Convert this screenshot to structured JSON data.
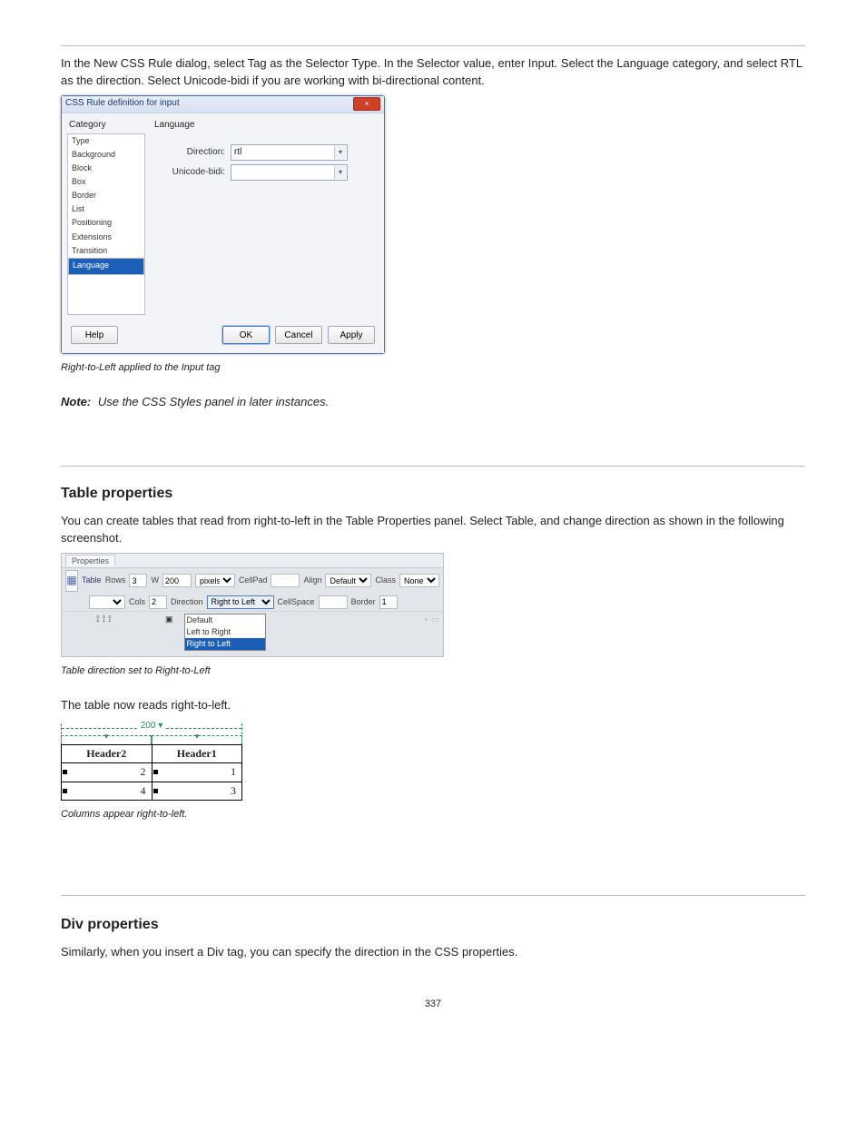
{
  "intro_paragraph": "In the New CSS Rule dialog, select Tag as the Selector Type. In the Selector value, enter Input. Select the Language category, and select RTL as the direction. Select Unicode-bidi if you are working with bi-directional content.",
  "dialog": {
    "title": "CSS Rule definition for input",
    "category_label": "Category",
    "right_label": "Language",
    "direction_label": "Direction:",
    "unicode_label": "Unicode-bidi:",
    "direction_value": "rtl",
    "unicode_value": "",
    "categories": [
      "Type",
      "Background",
      "Block",
      "Box",
      "Border",
      "List",
      "Positioning",
      "Extensions",
      "Transition",
      "Language"
    ],
    "selected_category_index": 9,
    "buttons": {
      "help": "Help",
      "ok": "OK",
      "cancel": "Cancel",
      "apply": "Apply"
    },
    "close_label": "×"
  },
  "caption1": "Right-to-Left applied to the Input tag",
  "note_label": "Note:",
  "note_text": "Use the CSS Styles panel in later instances.",
  "section_title": "Table properties",
  "para2a": "You can create tables that read from right-to-left in the Table Properties panel. Select Table, and change direction as shown in the following screenshot.",
  "props": {
    "tab": "Properties",
    "table_label": "Table",
    "rows_label": "Rows",
    "rows_value": "3",
    "cols_label": "Cols",
    "cols_value": "2",
    "w_label": "W",
    "w_value": "200",
    "w_unit": "pixels",
    "dir_label": "Direction",
    "dir_value": "Right to Left",
    "cellpad_label": "CellPad",
    "cellpad_value": "",
    "cellspace_label": "CellSpace",
    "cellspace_value": "",
    "border_label": "Border",
    "border_value": "1",
    "align_label": "Align",
    "align_value": "Default",
    "class_label": "Class",
    "class_value": "None",
    "dir_options": [
      "Default",
      "Left to Right",
      "Right to Left"
    ],
    "dir_sel_index": 2
  },
  "caption2": "Table direction set to Right-to-Left",
  "para2b": "The table now reads right-to-left.",
  "tabledemo": {
    "ruler_label": "200 ▾",
    "headers": [
      "Header2",
      "Header1"
    ],
    "rows": [
      [
        "2",
        "1"
      ],
      [
        "4",
        "3"
      ]
    ]
  },
  "caption3": "Columns appear right-to-left.",
  "div_title": "Div properties",
  "para3": "Similarly, when you insert a Div tag, you can specify the direction in the CSS properties.",
  "pagenum": "337"
}
